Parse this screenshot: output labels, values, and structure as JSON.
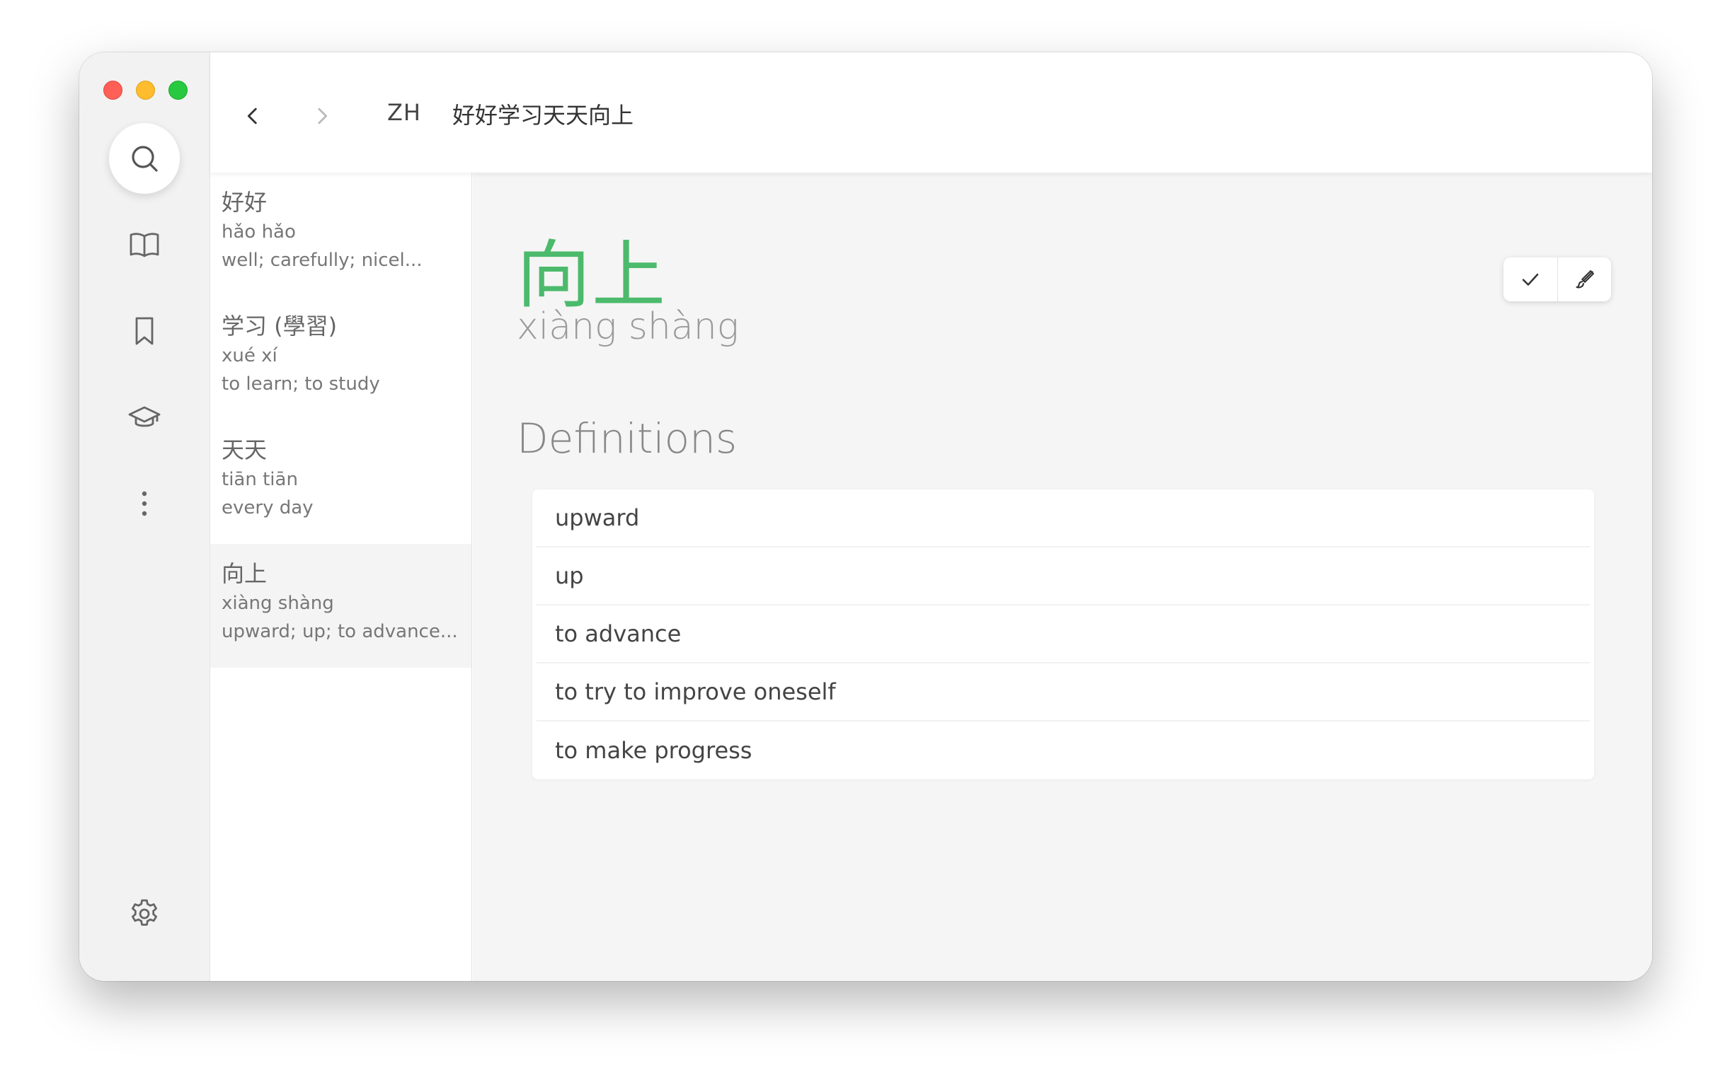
{
  "header": {
    "language": "ZH",
    "query": "好好学习天天向上"
  },
  "rail": {
    "icons": [
      "search-icon",
      "book-open-icon",
      "bookmark-icon",
      "graduation-cap-icon",
      "more-vertical-icon",
      "gear-icon"
    ]
  },
  "wordlist": {
    "items": [
      {
        "hanzi": "好好",
        "pinyin": "hǎo hǎo",
        "definition": "well; carefully; nicel..."
      },
      {
        "hanzi": "学习 (學習)",
        "pinyin": "xué xí",
        "definition": "to learn; to study"
      },
      {
        "hanzi": "天天",
        "pinyin": "tiān tiān",
        "definition": "every day"
      },
      {
        "hanzi": "向上",
        "pinyin": "xiàng shàng",
        "definition": "upward; up; to advance..."
      }
    ],
    "selected_index": 3
  },
  "detail": {
    "headword": "向上",
    "pinyin": "xiàng shàng",
    "section_title": "Definitions",
    "definitions": [
      "upward",
      "up",
      "to advance",
      "to try to improve oneself",
      "to make progress"
    ]
  },
  "colors": {
    "accent": "#4cba6c",
    "traffic_red": "#fe5f57",
    "traffic_yellow": "#febc2e",
    "traffic_green": "#28c840"
  }
}
